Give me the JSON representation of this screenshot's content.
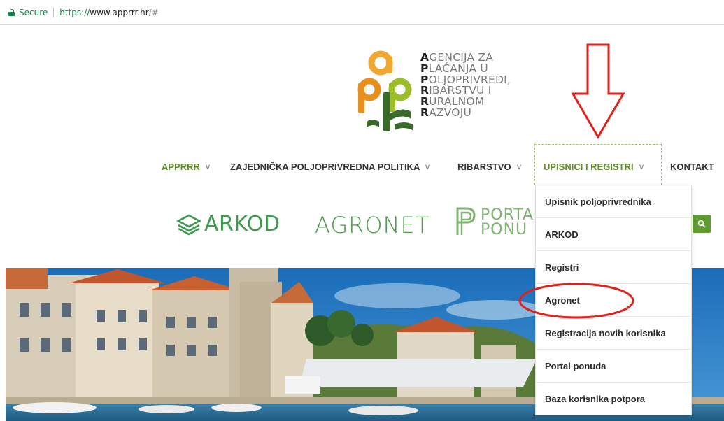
{
  "browser": {
    "secure_label": "Secure",
    "url_protocol": "https://",
    "url_host": "www.apprrr.hr",
    "url_rest": "/#"
  },
  "logo": {
    "lines": [
      {
        "first": "A",
        "rest": "GENCIJA ZA"
      },
      {
        "first": "P",
        "rest": "LAĆANJA U"
      },
      {
        "first": "P",
        "rest": "OLJOPRIVREDI,"
      },
      {
        "first": "R",
        "rest": "IBARSTVU I"
      },
      {
        "first": "R",
        "rest": "URALNOM"
      },
      {
        "first": "R",
        "rest": "AZVOJU"
      }
    ]
  },
  "nav": {
    "items": [
      {
        "label": "APPRRR"
      },
      {
        "label": "ZAJEDNIČKA POLJOPRIVREDNA POLITIKA"
      },
      {
        "label": "RIBARSTVO"
      },
      {
        "label": "UPISNICI I REGISTRI"
      },
      {
        "label": "KONTAKT"
      }
    ]
  },
  "brands": {
    "arkod": "ARKOD",
    "agronet": "AGRONET",
    "portal_line1": "PORTA",
    "portal_line2": "PONU"
  },
  "dropdown": {
    "items": [
      "Upisnik poljoprivrednika",
      "ARKOD",
      "Registri",
      "Agronet",
      "Registracija novih korisnika",
      "Portal ponuda",
      "Baza korisnika potpora"
    ]
  },
  "icons": {
    "lock": "lock-icon",
    "search": "search-icon",
    "chevron": "chevron-down-icon"
  },
  "colors": {
    "brand_green": "#5e8c2c",
    "secure_green": "#0b8043",
    "annotation_red": "#e0211c"
  }
}
